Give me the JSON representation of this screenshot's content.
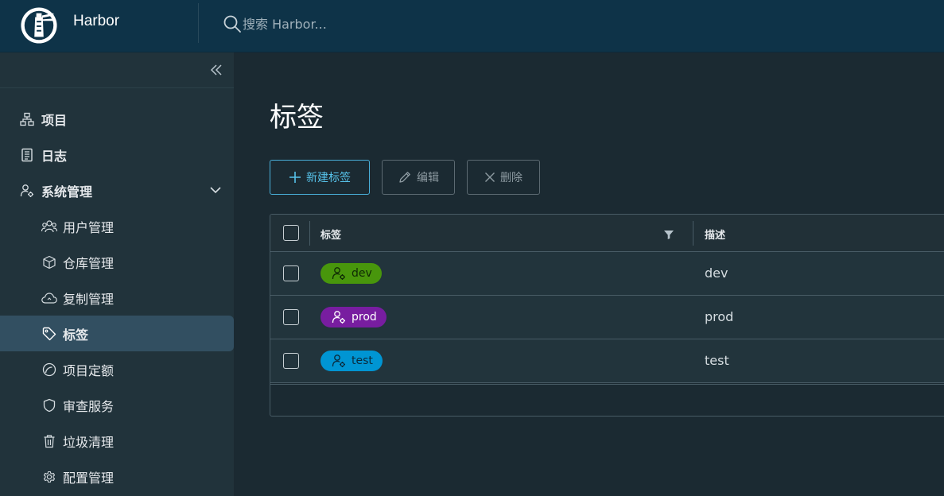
{
  "header": {
    "brand": "Harbor",
    "search_placeholder": "搜索 Harbor..."
  },
  "sidebar": {
    "items": [
      {
        "label": "项目",
        "icon": "project-hierarchy-icon"
      },
      {
        "label": "日志",
        "icon": "log-icon"
      },
      {
        "label": "系统管理",
        "icon": "admin-user-gear-icon",
        "expanded": true
      },
      {
        "label": "用户管理",
        "icon": "users-icon"
      },
      {
        "label": "仓库管理",
        "icon": "box-icon"
      },
      {
        "label": "复制管理",
        "icon": "cloud-icon"
      },
      {
        "label": "标签",
        "icon": "tag-icon",
        "active": true
      },
      {
        "label": "项目定额",
        "icon": "quota-gauge-icon"
      },
      {
        "label": "审查服务",
        "icon": "shield-icon"
      },
      {
        "label": "垃圾清理",
        "icon": "trash-icon"
      },
      {
        "label": "配置管理",
        "icon": "gear-icon"
      }
    ]
  },
  "main": {
    "title": "标签",
    "toolbar": {
      "new_label": "新建标签",
      "edit_label": "编辑",
      "delete_label": "删除"
    },
    "table": {
      "columns": [
        "标签",
        "描述"
      ],
      "rows": [
        {
          "label": "dev",
          "description": "dev",
          "color": "#48960c",
          "text_color": "#0f2a05"
        },
        {
          "label": "prod",
          "description": "prod",
          "color": "#781da0",
          "text_color": "#ffffff"
        },
        {
          "label": "test",
          "description": "test",
          "color": "#0095d3",
          "text_color": "#0a2a3c"
        }
      ]
    }
  },
  "colors": {
    "header_bg": "#0e3348",
    "sidebar_bg": "#21333b",
    "active_bg": "#324f61",
    "content_bg": "#1b2a32",
    "accent": "#49afd9"
  }
}
